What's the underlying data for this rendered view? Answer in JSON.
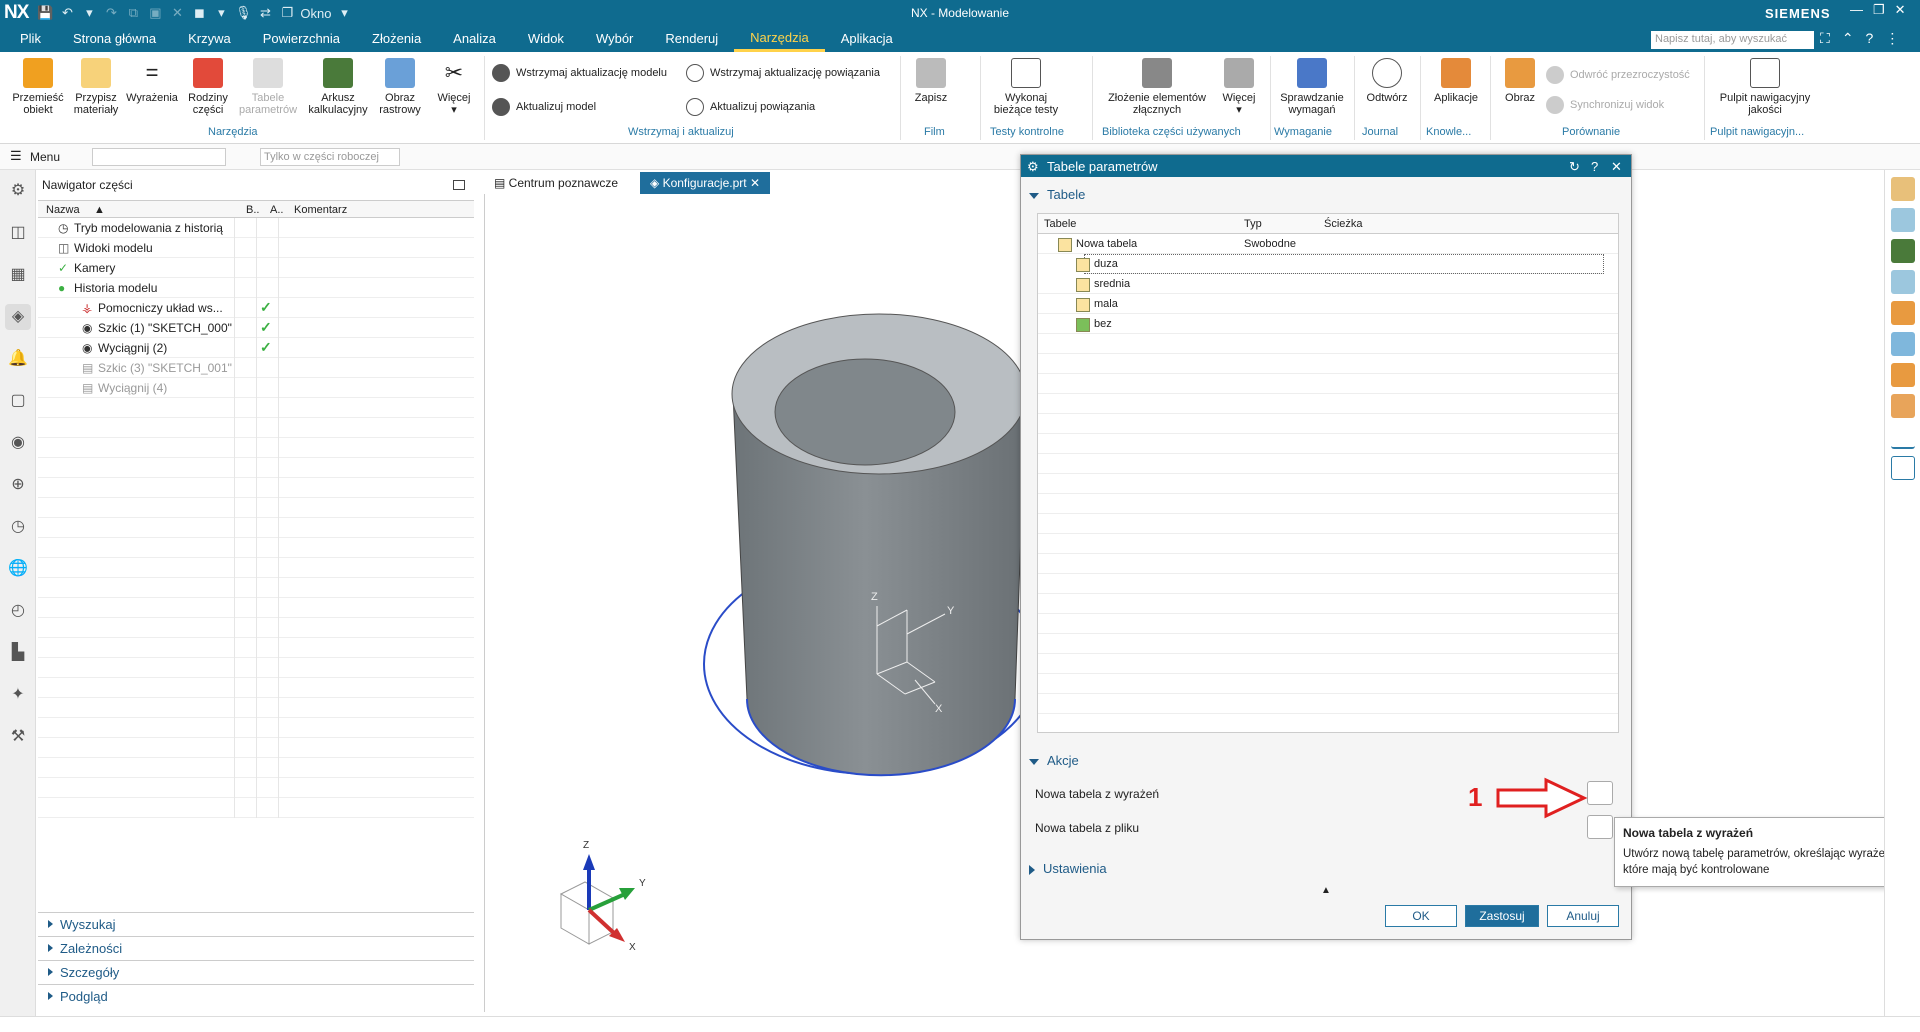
{
  "app": {
    "logo": "NX",
    "title": "NX - Modelowanie",
    "brand": "SIEMENS",
    "window_menu": "Okno",
    "search_placeholder": "Napisz tutaj, aby wyszukać"
  },
  "menu": [
    "Plik",
    "Strona główna",
    "Krzywa",
    "Powierzchnia",
    "Złożenia",
    "Analiza",
    "Widok",
    "Wybór",
    "Renderuj",
    "Narzędzia",
    "Aplikacja"
  ],
  "ribbon": {
    "buttons": [
      {
        "label": "Przemieść obiekt",
        "l1": "Przemieść",
        "l2": "obiekt"
      },
      {
        "label": "Przypisz materiały",
        "l1": "Przypisz",
        "l2": "materiały"
      },
      {
        "label": "Wyrażenia",
        "l1": "Wyrażenia",
        "l2": ""
      },
      {
        "label": "Rodziny części",
        "l1": "Rodziny",
        "l2": "części"
      },
      {
        "label": "Tabele parametrów",
        "l1": "Tabele",
        "l2": "parametrów"
      },
      {
        "label": "Arkusz kalkulacyjny",
        "l1": "Arkusz",
        "l2": "kalkulacyjny"
      },
      {
        "label": "Obraz rastrowy",
        "l1": "Obraz",
        "l2": "rastrowy"
      },
      {
        "label": "Więcej",
        "l1": "Więcej",
        "l2": ""
      }
    ],
    "small": {
      "s1": "Wstrzymaj aktualizację modelu",
      "s2": "Aktualizuj model",
      "s3": "Wstrzymaj aktualizację powiązania",
      "s4": "Aktualizuj powiązania",
      "zapisz": "Zapisz",
      "wykonaj1": "Wykonaj",
      "wykonaj2": "bieżące testy",
      "zlozenie1": "Złożenie elementów",
      "zlozenie2": "złącznych",
      "wiecej": "Więcej",
      "spraw1": "Sprawdzanie",
      "spraw2": "wymagań",
      "odtworz": "Odtwórz",
      "aplikacje": "Aplikacje",
      "obraz": "Obraz",
      "odwroc": "Odwróć przezroczystość",
      "synch": "Synchronizuj widok",
      "pulpit1": "Pulpit nawigacyjny",
      "pulpit2": "jakości"
    },
    "groups": {
      "narzedzia": "Narzędzia",
      "wstrzymaj": "Wstrzymaj i aktualizuj",
      "film": "Film",
      "testy": "Testy kontrolne",
      "biblioteka": "Biblioteka części używanych",
      "wymaganie": "Wymaganie",
      "journal": "Journal",
      "knowle": "Knowle...",
      "porownanie": "Porównanie",
      "pulpit": "Pulpit nawigacyjn..."
    }
  },
  "toolbar2": {
    "menu": "Menu",
    "filter": "Tylko w części roboczej"
  },
  "navigator": {
    "title": "Nawigator części",
    "columns": {
      "name": "Nazwa",
      "b": "B..",
      "a": "A..",
      "comment": "Komentarz"
    },
    "rows": [
      {
        "name": "Tryb modelowania z historią"
      },
      {
        "name": "Widoki modelu"
      },
      {
        "name": "Kamery"
      },
      {
        "name": "Historia modelu"
      },
      {
        "name": "Pomocniczy układ ws..."
      },
      {
        "name": "Szkic (1) \"SKETCH_000\""
      },
      {
        "name": "Wyciągnij (2)"
      },
      {
        "name": "Szkic (3) \"SKETCH_001\""
      },
      {
        "name": "Wyciągnij (4)"
      }
    ],
    "sections": [
      "Wyszukaj",
      "Zależności",
      "Szczegóły",
      "Podgląd"
    ]
  },
  "tabs": {
    "tab1": "Centrum poznawcze",
    "tab2": "Konfiguracje.prt"
  },
  "dialog": {
    "title": "Tabele parametrów",
    "section_tables": "Tabele",
    "columns": {
      "tabele": "Tabele",
      "typ": "Typ",
      "sciezka": "Ścieżka"
    },
    "rows": [
      {
        "name": "Nowa tabela",
        "type": "Swobodne"
      },
      {
        "name": "duza",
        "type": ""
      },
      {
        "name": "srednia",
        "type": ""
      },
      {
        "name": "mala",
        "type": ""
      },
      {
        "name": "bez",
        "type": ""
      }
    ],
    "section_actions": "Akcje",
    "action1": "Nowa tabela z wyrażeń",
    "action2": "Nowa tabela z pliku",
    "section_settings": "Ustawienia",
    "ok": "OK",
    "apply": "Zastosuj",
    "cancel": "Anuluj"
  },
  "annotation": {
    "number": "1"
  },
  "tooltip": {
    "title": "Nowa tabela z wyrażeń",
    "desc": "Utwórz nową tabelę parametrów, określając wyrażenia, które mają być kontrolowane"
  },
  "axes": {
    "x": "X",
    "y": "Y",
    "z": "Z"
  },
  "colors": {
    "titlebar": "#0f6b8f",
    "accent": "#ffd24a",
    "link": "#1f5b87",
    "arrow": "#e02020"
  }
}
